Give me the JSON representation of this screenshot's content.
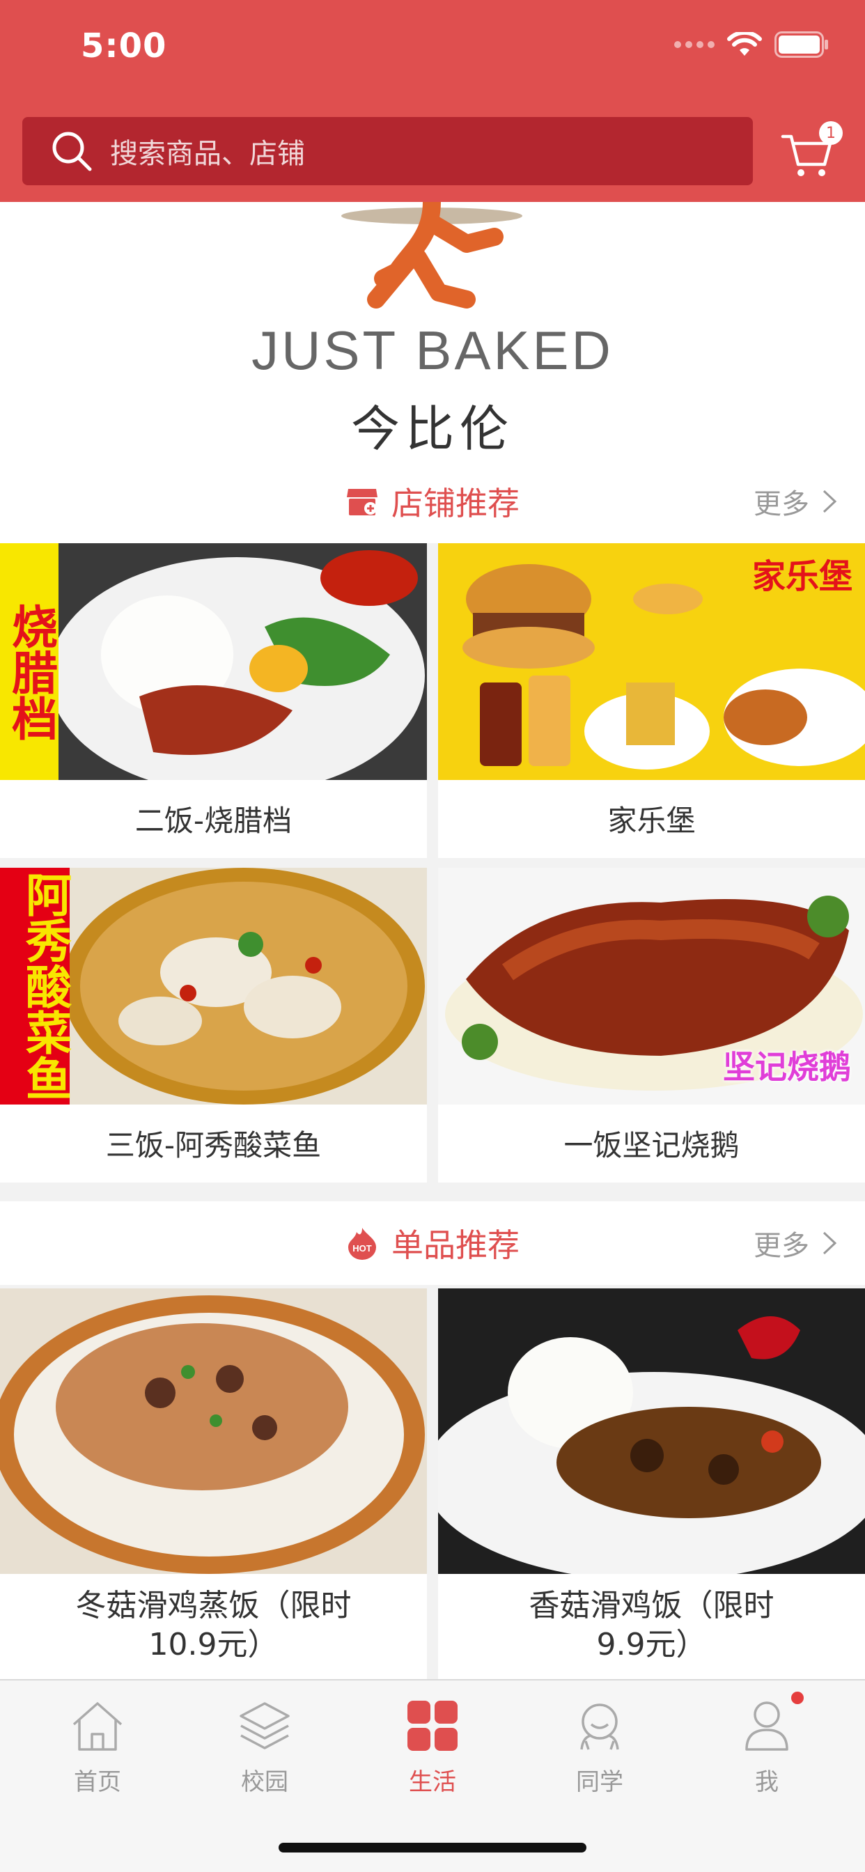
{
  "status": {
    "time": "5:00"
  },
  "search": {
    "placeholder": "搜索商品、店铺"
  },
  "cart": {
    "badge": "1"
  },
  "banner": {
    "brand_en_1": "JUST B",
    "brand_en_2": "AKED",
    "brand_cn": "今比伦"
  },
  "shops": {
    "title": "店铺推荐",
    "more": "更多",
    "items": [
      {
        "name": "二饭-烧腊档",
        "tag": "烧腊档"
      },
      {
        "name": "家乐堡",
        "tag": "家乐堡"
      },
      {
        "name": "三饭-阿秀酸菜鱼",
        "tag": "阿秀酸菜鱼"
      },
      {
        "name": "一饭坚记烧鹅",
        "tag": "坚记烧鹅"
      }
    ]
  },
  "products": {
    "title": "单品推荐",
    "more": "更多",
    "items": [
      {
        "name_line1": "冬菇滑鸡蒸饭（限时",
        "name_line2": "10.9元）"
      },
      {
        "name_line1": "香菇滑鸡饭（限时",
        "name_line2": "9.9元）"
      }
    ]
  },
  "tabbar": {
    "items": [
      {
        "label": "首页",
        "icon": "home-icon"
      },
      {
        "label": "校园",
        "icon": "layers-icon"
      },
      {
        "label": "生活",
        "icon": "grid-icon"
      },
      {
        "label": "同学",
        "icon": "classmate-icon"
      },
      {
        "label": "我",
        "icon": "profile-icon"
      }
    ],
    "active_index": 2
  },
  "colors": {
    "brand": "#df4f4f",
    "search_bg": "#b3262f",
    "text": "#333333",
    "muted": "#999999"
  }
}
